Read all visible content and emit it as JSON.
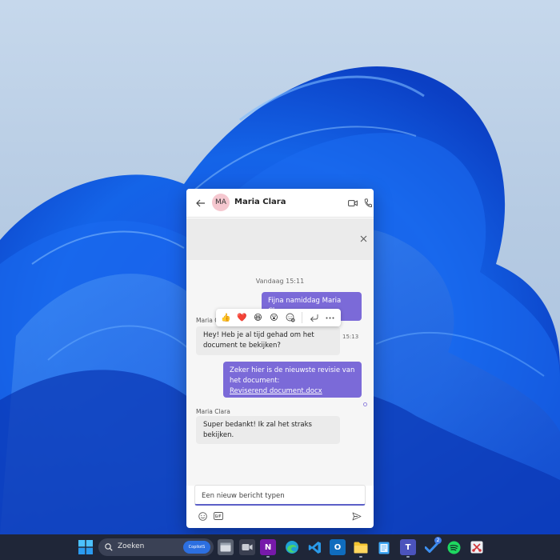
{
  "chat": {
    "contact_name": "Maria Clara",
    "avatar_initials": "MA",
    "date_separator": "Vandaag 15:11",
    "messages": [
      {
        "text": "Fijna namiddag Maria Clara"
      },
      {
        "sender": "Maria C",
        "text": "Hey! Heb je al tijd gehad om het document te bekijken?",
        "time": "15:13"
      },
      {
        "line1": "Zeker hier is de nieuwste revisie van",
        "line2": "het document:",
        "link": "Reviserend document.docx"
      },
      {
        "sender": "Maria Clara",
        "text": "Super bedankt! Ik zal het straks bekijken."
      }
    ],
    "compose_placeholder": "Een nieuw bericht typen"
  },
  "reactions": [
    "👍",
    "❤️",
    "😆",
    "😮"
  ],
  "taskbar": {
    "search_label": "Zoeken",
    "search_pill": "CopilotS",
    "badge_count": "2"
  },
  "colors": {
    "accent": "#5b5fc7",
    "outgoing_bubble": "#7b6ad8",
    "taskbar": "#1f2638"
  }
}
